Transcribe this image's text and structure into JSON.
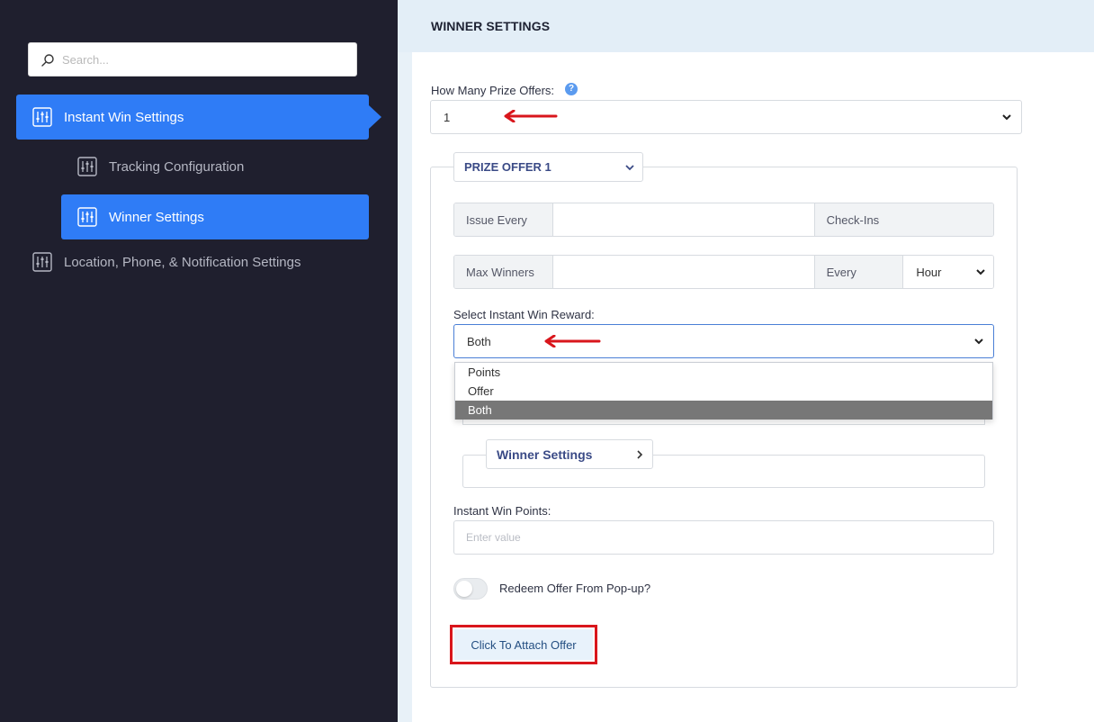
{
  "sidebar": {
    "search_placeholder": "Search...",
    "items": [
      {
        "label": "Instant Win Settings",
        "active": true
      },
      {
        "label": "Tracking Configuration",
        "active": false
      },
      {
        "label": "Winner Settings",
        "active": true
      },
      {
        "label": "Location, Phone, & Notification Settings",
        "active": false
      }
    ]
  },
  "main": {
    "title": "WINNER SETTINGS",
    "prize_offers_label": "How Many Prize Offers:",
    "help_glyph": "?",
    "prize_offers_value": "1",
    "prize_offer_tab": "PRIZE OFFER 1",
    "issue_every_label": "Issue Every",
    "issue_every_value": "",
    "checkins_label": "Check-Ins",
    "max_winners_label": "Max Winners",
    "max_winners_value": "",
    "every_label": "Every",
    "period_value": "Hour",
    "reward_label": "Select Instant Win Reward:",
    "reward_value": "Both",
    "reward_options": [
      "Points",
      "Offer",
      "Both"
    ],
    "winner_settings_tab": "Winner Settings",
    "instant_win_points_label": "Instant Win Points:",
    "instant_win_points_placeholder": "Enter value",
    "redeem_popup_label": "Redeem Offer From Pop-up?",
    "redeem_popup_on": false,
    "attach_offer_button": "Click To Attach Offer"
  },
  "colors": {
    "sidebar_bg": "#1f1f2e",
    "accent": "#2f7cf6",
    "annotation_red": "#d9161c"
  }
}
